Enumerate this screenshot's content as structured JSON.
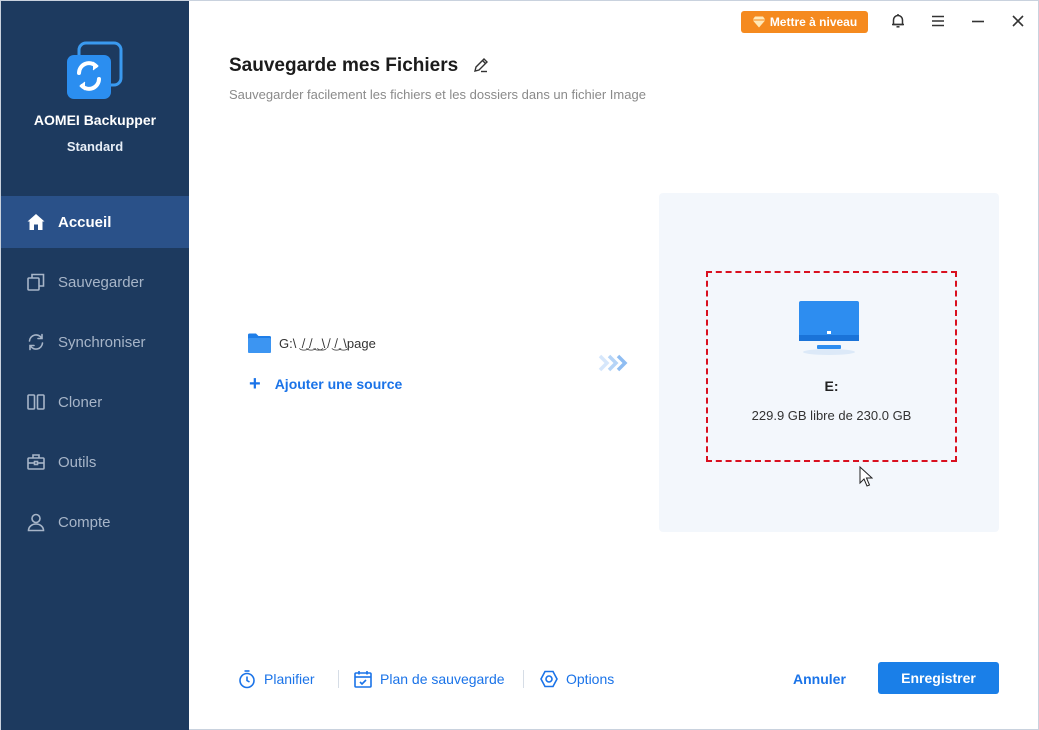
{
  "app": {
    "name": "AOMEI Backupper",
    "edition": "Standard",
    "upgrade_label": "Mettre à niveau",
    "colors": {
      "sidebar": "#1d3a5f",
      "active": "#2a5189",
      "accent": "#1a73e8",
      "upgrade": "#f58a1f",
      "highlight_border": "#d9101f"
    }
  },
  "sidebar": {
    "items": [
      {
        "label": "Accueil",
        "icon": "home-icon",
        "active": true
      },
      {
        "label": "Sauvegarder",
        "icon": "backup-icon",
        "active": false
      },
      {
        "label": "Synchroniser",
        "icon": "sync-icon",
        "active": false
      },
      {
        "label": "Cloner",
        "icon": "clone-icon",
        "active": false
      },
      {
        "label": "Outils",
        "icon": "tools-icon",
        "active": false
      },
      {
        "label": "Compte",
        "icon": "account-icon",
        "active": false
      }
    ]
  },
  "header": {
    "title": "Sauvegarde mes Fichiers",
    "subtitle": "Sauvegarder facilement les fichiers et les dossiers dans un fichier Image"
  },
  "source": {
    "path": "G:\\ ͜ ̸ ͜ ̸ ͜ ͜ \\ ̸ ͜ ̸ ͜ \\page",
    "add_label": "Ajouter une source"
  },
  "destination": {
    "drive": "E:",
    "space": "229.9 GB libre de 230.0 GB"
  },
  "footer": {
    "schedule": "Planifier",
    "backup_plan": "Plan de sauvegarde",
    "options": "Options",
    "cancel": "Annuler",
    "save": "Enregistrer"
  }
}
